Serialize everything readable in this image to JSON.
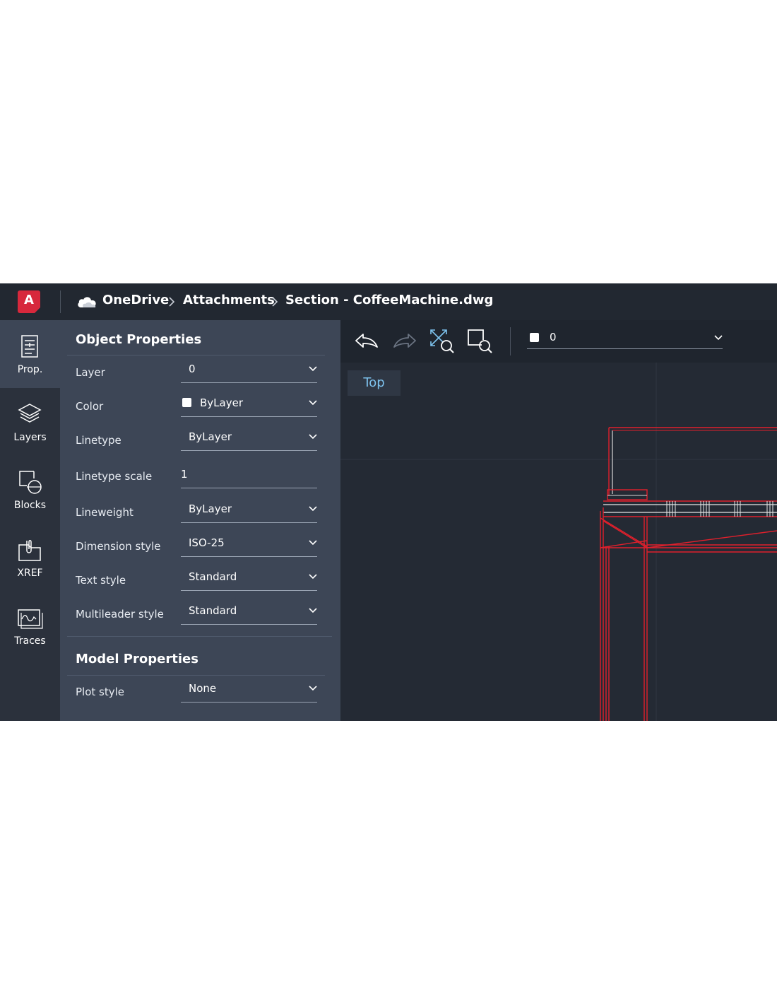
{
  "app": {
    "logo_letter": "A",
    "logo_icon": "autocad-logo-icon",
    "brand_color": "#d7283c"
  },
  "breadcrumb": {
    "cloud_icon": "cloud-icon",
    "items": [
      "OneDrive",
      "Attachments",
      "Section - CoffeeMachine.dwg"
    ],
    "separator_icon": "chevron-right-icon"
  },
  "sidebar": {
    "items": [
      {
        "label": "Prop.",
        "icon": "properties-icon",
        "active": true
      },
      {
        "label": "Layers",
        "icon": "layers-icon",
        "active": false
      },
      {
        "label": "Blocks",
        "icon": "blocks-icon",
        "active": false
      },
      {
        "label": "XREF",
        "icon": "xref-icon",
        "active": false
      },
      {
        "label": "Traces",
        "icon": "traces-icon",
        "active": false
      }
    ]
  },
  "object_properties": {
    "title": "Object Properties",
    "rows": [
      {
        "label": "Layer",
        "value": "0",
        "control": "dropdown"
      },
      {
        "label": "Color",
        "value": "ByLayer",
        "control": "dropdown",
        "swatch": "#ffffff"
      },
      {
        "label": "Linetype",
        "value": "ByLayer",
        "control": "dropdown"
      },
      {
        "label": "Linetype scale",
        "value": "1",
        "control": "input"
      },
      {
        "label": "Lineweight",
        "value": "ByLayer",
        "control": "dropdown"
      },
      {
        "label": "Dimension style",
        "value": "ISO-25",
        "control": "dropdown"
      },
      {
        "label": "Text style",
        "value": "Standard",
        "control": "dropdown"
      },
      {
        "label": "Multileader style",
        "value": "Standard",
        "control": "dropdown"
      }
    ]
  },
  "model_properties": {
    "title": "Model Properties",
    "rows": [
      {
        "label": "Plot style",
        "value": "None",
        "control": "dropdown"
      }
    ]
  },
  "toolbar": {
    "buttons": [
      {
        "icon": "undo-icon"
      },
      {
        "icon": "redo-icon"
      },
      {
        "icon": "zoom-extents-icon"
      },
      {
        "icon": "zoom-window-icon"
      }
    ],
    "layer_select": {
      "value": "0",
      "swatch": "#ffffff"
    }
  },
  "viewport": {
    "view_label": "Top",
    "drawing_color": "#e0202c",
    "accent_color": "#7ec3ef"
  }
}
